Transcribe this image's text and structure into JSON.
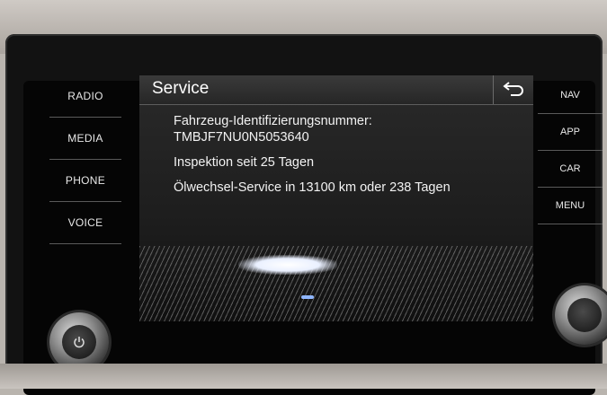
{
  "left_keys": [
    "RADIO",
    "MEDIA",
    "PHONE",
    "VOICE"
  ],
  "right_keys": [
    "NAV",
    "APP",
    "CAR",
    "MENU"
  ],
  "screen": {
    "title": "Service",
    "back_icon": "return-arrow-icon",
    "vin_label": "Fahrzeug-Identifizierungsnummer:",
    "vin_value": "TMBJF7NU0N5053640",
    "inspection": "Inspektion seit 25 Tagen",
    "oil_service": "Ölwechsel-Service in 13100 km oder 238 Tagen"
  },
  "knobs": {
    "left_icon": "power-icon",
    "right_icon": "tuning-knob-icon"
  },
  "colors": {
    "screen_bg": "#1f1f1f",
    "text": "#f2f2f2",
    "bezel": "#121212"
  }
}
